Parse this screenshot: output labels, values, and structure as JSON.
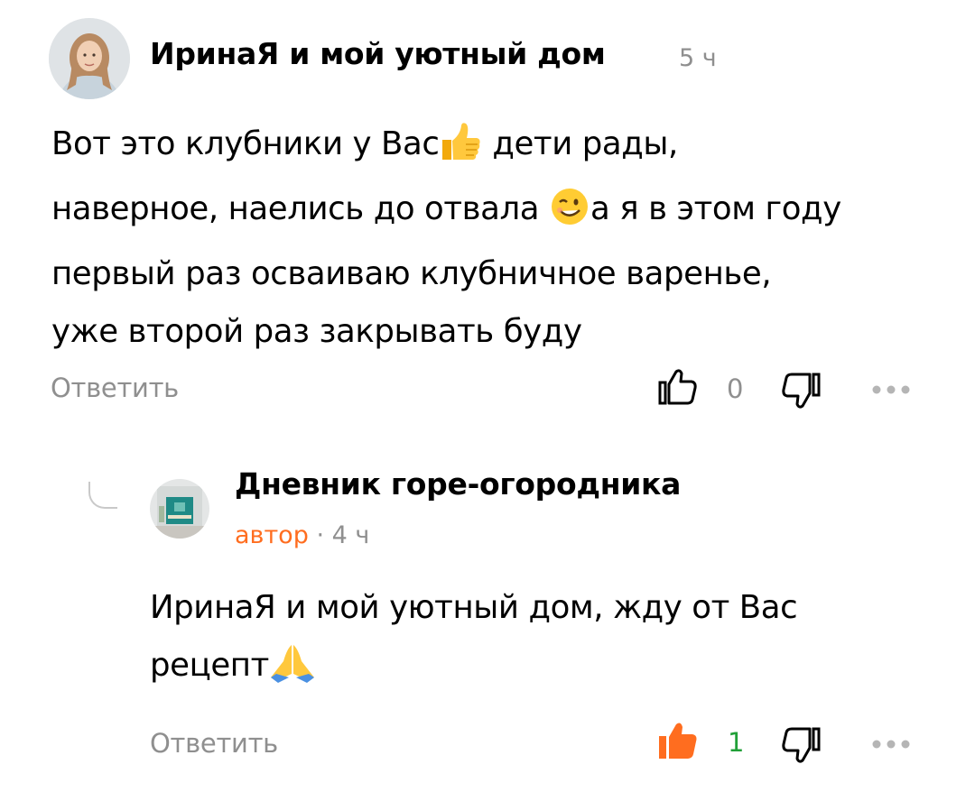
{
  "comments": [
    {
      "author": "ИринаЯ и мой уютный дом",
      "time": "5 ч",
      "avatar_icon": "woman-portrait-avatar",
      "text_lines": [
        [
          "Вот это клубники у Вас",
          "👍",
          " дети рады,"
        ],
        [
          "наверное, наелись до отвала ",
          "😉",
          "а я в этом году"
        ],
        [
          "первый раз осваиваю клубничное варенье,"
        ],
        [
          "уже второй раз закрывать буду"
        ]
      ],
      "reply_label": "Ответить",
      "like_count": "0",
      "liked": false
    },
    {
      "author": "Дневник горе-огородника",
      "role_badge": "автор",
      "separator": "·",
      "time": "4 ч",
      "avatar_icon": "room-interior-avatar",
      "text_lines": [
        [
          "ИринаЯ и мой уютный дом, жду от Вас"
        ],
        [
          "рецепт",
          "🙏"
        ]
      ],
      "reply_label": "Ответить",
      "like_count": "1",
      "liked": true
    }
  ],
  "colors": {
    "text": "#000000",
    "muted": "#8f8f8f",
    "author_badge": "#ff6d1f",
    "liked_icon": "#ff6d1f",
    "liked_count": "#21a038",
    "icon": "#000000"
  }
}
